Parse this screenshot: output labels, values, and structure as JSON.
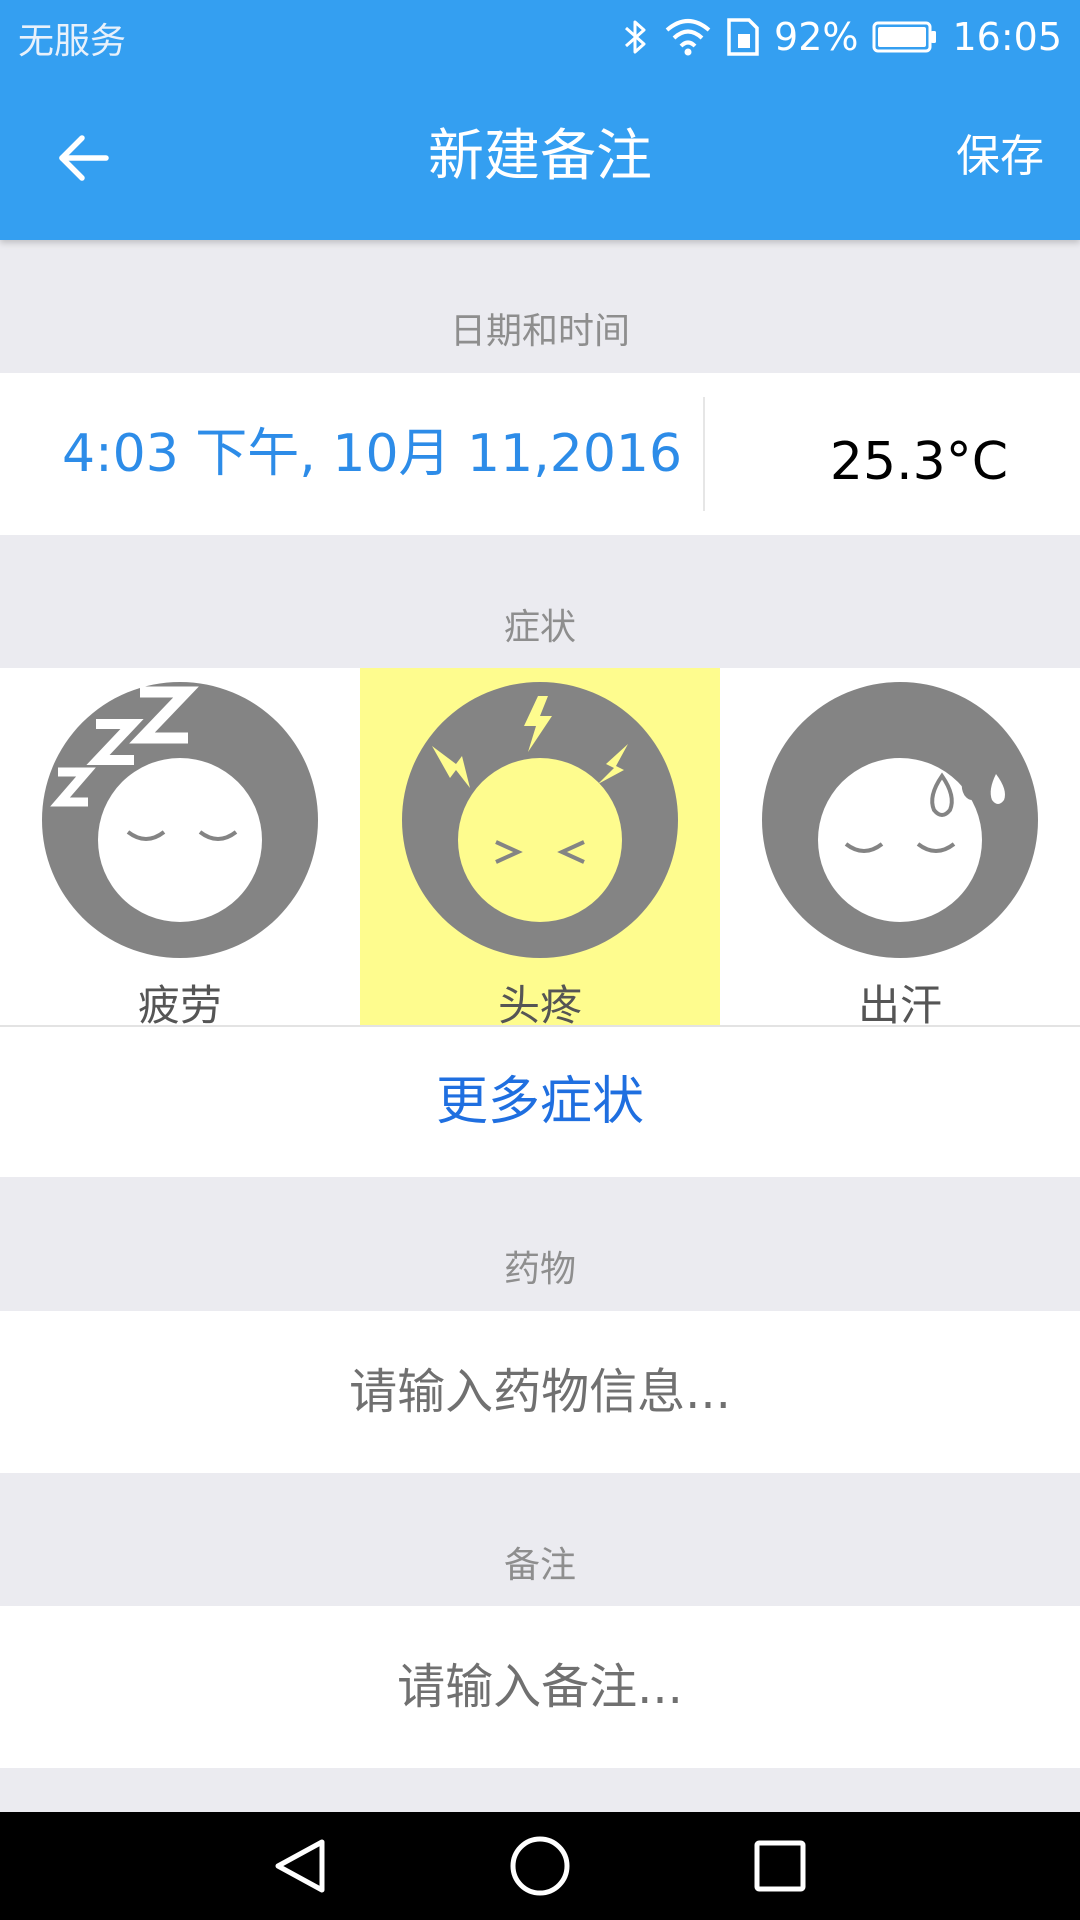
{
  "status_bar": {
    "carrier": "无服务",
    "battery_percent": "92%",
    "time": "16:05",
    "icons": [
      "bluetooth-icon",
      "wifi-icon",
      "sim-icon",
      "battery-icon"
    ]
  },
  "toolbar": {
    "back_icon": "arrow-left-icon",
    "title": "新建备注",
    "save_label": "保存"
  },
  "datetime_section": {
    "label": "日期和时间",
    "datetime": "4:03 下午, 10月 11,2016",
    "temperature": "25.3°C"
  },
  "symptoms_section": {
    "label": "症状",
    "items": [
      {
        "label": "疲劳",
        "icon": "sleepy-face-icon",
        "selected": false
      },
      {
        "label": "头疼",
        "icon": "headache-face-icon",
        "selected": true
      },
      {
        "label": "出汗",
        "icon": "sweating-face-icon",
        "selected": false
      }
    ],
    "more_label": "更多症状"
  },
  "medication_section": {
    "label": "药物",
    "placeholder": "请输入药物信息..."
  },
  "notes_section": {
    "label": "备注",
    "placeholder": "请输入备注..."
  },
  "nav_bar": {
    "icons": [
      "back-triangle-icon",
      "home-circle-icon",
      "recents-square-icon"
    ]
  },
  "colors": {
    "header": "#349ff1",
    "background": "#ebebf0",
    "accent_text": "#2d8ce8",
    "link": "#1f6fe0",
    "selected_highlight": "#fefc8e",
    "icon_gray": "#848484"
  }
}
